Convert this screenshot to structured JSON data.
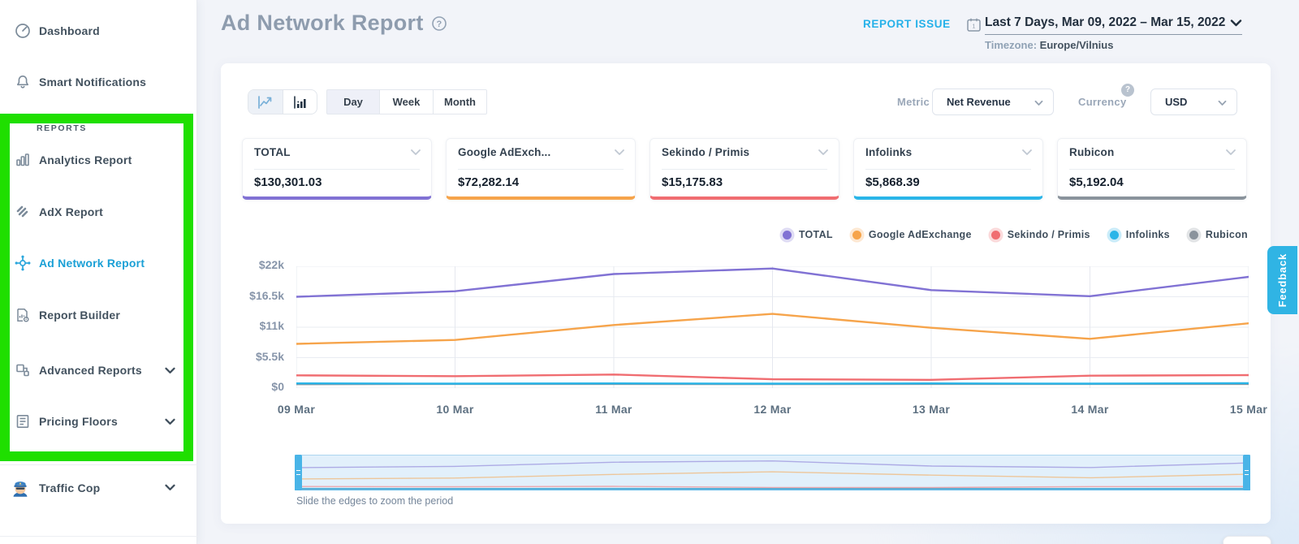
{
  "sidebar": {
    "dashboard": "Dashboard",
    "notifications": "Smart Notifications",
    "reports_header": "REPORTS",
    "report_items": [
      "Analytics Report",
      "AdX Report",
      "Ad Network Report",
      "Report Builder",
      "Advanced Reports",
      "Pricing Floors"
    ],
    "traffic_cop": "Traffic Cop"
  },
  "header": {
    "title": "Ad Network Report",
    "report_issue": "REPORT ISSUE",
    "date_range_label": "Last 7 Days,",
    "date_range_value": " Mar 09, 2022 – Mar 15, 2022",
    "timezone_label": "Timezone: ",
    "timezone_value": "Europe/Vilnius"
  },
  "controls": {
    "period_tabs": [
      "Day",
      "Week",
      "Month"
    ],
    "metric_label": "Metric",
    "metric_value": "Net Revenue",
    "currency_label": "Currency",
    "currency_help": "?",
    "currency_value": "USD"
  },
  "cards": [
    {
      "title": "TOTAL",
      "value": "$130,301.03",
      "accent": "#8172d4"
    },
    {
      "title": "Google AdExch...",
      "value": "$72,282.14",
      "accent": "#f6a44b"
    },
    {
      "title": "Sekindo / Primis",
      "value": "$15,175.83",
      "accent": "#f06d71"
    },
    {
      "title": "Infolinks",
      "value": "$5,868.39",
      "accent": "#2ab5e8"
    },
    {
      "title": "Rubicon",
      "value": "$5,192.04",
      "accent": "#8a939c"
    }
  ],
  "chart_data": {
    "type": "line",
    "x": [
      "09 Mar",
      "10 Mar",
      "11 Mar",
      "12 Mar",
      "13 Mar",
      "14 Mar",
      "15 Mar"
    ],
    "ylabel_ticks": [
      "$22k",
      "$16.5k",
      "$11k",
      "$5.5k",
      "$0"
    ],
    "ylim": [
      0,
      22000
    ],
    "grid": true,
    "legend_position": "top-right",
    "series": [
      {
        "name": "TOTAL",
        "color": "#8172d4",
        "values": [
          16500,
          17500,
          20600,
          21600,
          17700,
          16600,
          20100
        ]
      },
      {
        "name": "Google AdExchange",
        "color": "#f6a44b",
        "values": [
          8000,
          8700,
          11400,
          13400,
          10900,
          8900,
          11700
        ]
      },
      {
        "name": "Sekindo / Primis",
        "color": "#f06d71",
        "values": [
          2300,
          2150,
          2450,
          1600,
          1500,
          2250,
          2350
        ]
      },
      {
        "name": "Infolinks",
        "color": "#2ab5e8",
        "values": [
          850,
          800,
          850,
          800,
          850,
          800,
          900
        ]
      },
      {
        "name": "Rubicon",
        "color": "#8a939c",
        "values": [
          700,
          750,
          750,
          720,
          750,
          750,
          750
        ]
      }
    ]
  },
  "slider_caption": "Slide the edges to zoom the period",
  "feedback_label": "Feedback",
  "help_glyph": "?"
}
